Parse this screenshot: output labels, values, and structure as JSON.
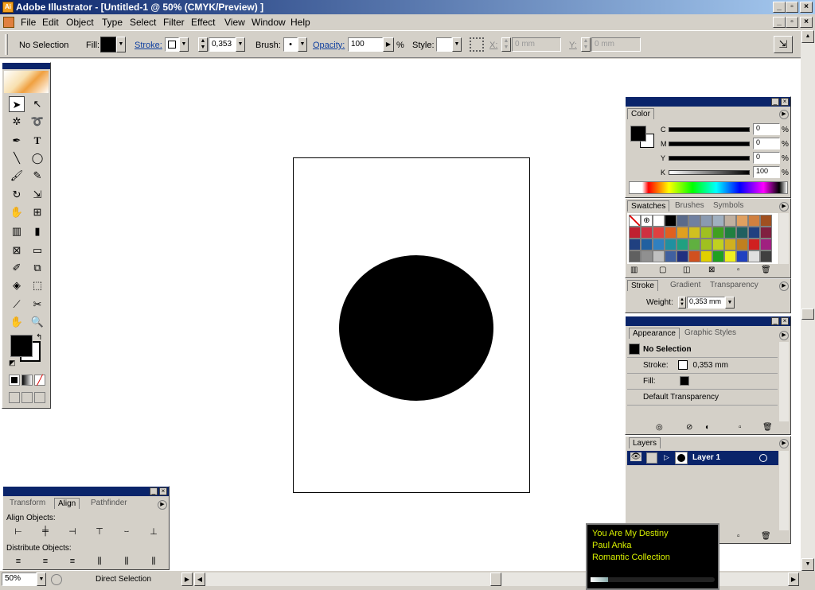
{
  "window": {
    "title": "Adobe Illustrator - [Untitled-1 @ 50% (CMYK/Preview) ]",
    "app_icon": "Ai"
  },
  "menu": [
    "File",
    "Edit",
    "Object",
    "Type",
    "Select",
    "Filter",
    "Effect",
    "View",
    "Window",
    "Help"
  ],
  "control": {
    "selection": "No Selection",
    "fill_label": "Fill:",
    "stroke_label": "Stroke:",
    "stroke_weight": "0,353",
    "brush_label": "Brush:",
    "brush_value": "•",
    "opacity_label": "Opacity:",
    "opacity_value": "100",
    "opacity_unit": "%",
    "style_label": "Style:",
    "x_label": "X:",
    "x_value": "0 mm",
    "y_label": "Y:",
    "y_value": "0 mm"
  },
  "canvas": {
    "background": "#ffffff",
    "shape_color": "#000000"
  },
  "toolbox": {
    "tools": [
      "selection-tool",
      "direct-selection-tool",
      "magic-wand-tool",
      "lasso-tool",
      "pen-tool",
      "type-tool",
      "line-tool",
      "ellipse-tool",
      "paintbrush-tool",
      "pencil-tool",
      "rotate-tool",
      "scale-tool",
      "warp-tool",
      "free-transform-tool",
      "symbol-sprayer-tool",
      "graph-tool",
      "mesh-tool",
      "gradient-tool",
      "eyedropper-tool",
      "blend-tool",
      "live-paint-tool",
      "slice-select-tool",
      "slice-tool",
      "scissors-tool",
      "hand-tool",
      "zoom-tool"
    ]
  },
  "color_panel": {
    "tab": "Color",
    "channels": [
      {
        "label": "C",
        "value": "0"
      },
      {
        "label": "M",
        "value": "0"
      },
      {
        "label": "Y",
        "value": "0"
      },
      {
        "label": "K",
        "value": "100"
      }
    ],
    "unit": "%"
  },
  "swatches_panel": {
    "tabs": [
      "Swatches",
      "Brushes",
      "Symbols"
    ],
    "colors": [
      "#ffffff",
      "#ffffff",
      "#ffffff",
      "#000000",
      "#5a6a8a",
      "#7080a0",
      "#8a9ab0",
      "#a0b0c0",
      "#c0b0a0",
      "#e0a060",
      "#d08040",
      "#a05020",
      "#c02030",
      "#d03040",
      "#e04040",
      "#e06020",
      "#e0a020",
      "#d0c020",
      "#a0c020",
      "#40a020",
      "#208040",
      "#206060",
      "#204080",
      "#802040",
      "#204080",
      "#2060a0",
      "#3080c0",
      "#2090a0",
      "#20a080",
      "#60b040",
      "#a0c020",
      "#c0d020",
      "#d0b020",
      "#c08020",
      "#d02020",
      "#a02080",
      "#606060",
      "#909090",
      "#c0c0c0",
      "#4060a0",
      "#203080",
      "#d05020",
      "#e0d000",
      "#20a020",
      "#f0f020",
      "#2040c0",
      "#e0e0e0",
      "#404040"
    ]
  },
  "stroke_panel": {
    "tabs": [
      "Stroke",
      "Gradient",
      "Transparency"
    ],
    "weight_label": "Weight:",
    "weight_value": "0,353 mm"
  },
  "appearance_panel": {
    "tabs": [
      "Appearance",
      "Graphic Styles"
    ],
    "header": "No Selection",
    "stroke_label": "Stroke:",
    "stroke_value": "0,353 mm",
    "fill_label": "Fill:",
    "transparency": "Default Transparency"
  },
  "layers_panel": {
    "tab": "Layers",
    "layer_name": "Layer 1"
  },
  "align_panel": {
    "tabs": [
      "Transform",
      "Align",
      "Pathfinder"
    ],
    "align_label": "Align Objects:",
    "distribute_label": "Distribute Objects:"
  },
  "status": {
    "zoom": "50%",
    "tool_status": "Direct Selection"
  },
  "media_player": {
    "song": "You Are My Destiny",
    "artist": "Paul Anka",
    "album": "Romantic Collection"
  },
  "colors": {
    "title_bar": "#0a246a",
    "ui_face": "#d4d0c8",
    "layer_highlight": "#0a246a",
    "media_text": "#d8f000"
  }
}
